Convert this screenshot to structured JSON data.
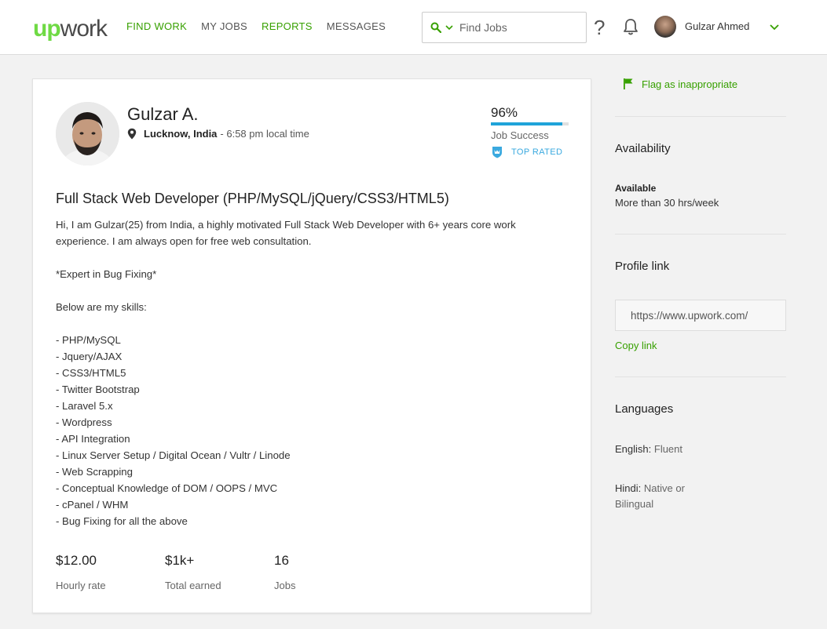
{
  "header": {
    "logo_up": "up",
    "logo_work": "work",
    "nav": [
      {
        "label": "FIND WORK"
      },
      {
        "label": "MY JOBS"
      },
      {
        "label": "REPORTS"
      },
      {
        "label": "MESSAGES"
      }
    ],
    "search_placeholder": "Find Jobs",
    "help_glyph": "?",
    "user_name": "Gulzar Ahmed"
  },
  "profile": {
    "name": "Gulzar A.",
    "city": "Lucknow, India",
    "local_time": "- 6:58 pm local time",
    "job_success_pct": "96%",
    "job_success_value": 0.92,
    "job_success_label": "Job Success",
    "top_rated": "TOP RATED",
    "title": "Full Stack Web Developer (PHP/MySQL/jQuery/CSS3/HTML5)",
    "description": [
      "Hi, I am Gulzar(25) from India, a highly motivated Full Stack Web Developer with 6+ years core work experience. I am always open for free web consultation.",
      "",
      "*Expert in Bug Fixing*",
      "",
      "Below are my skills:",
      "",
      "- PHP/MySQL",
      "- Jquery/AJAX",
      "- CSS3/HTML5",
      "- Twitter Bootstrap",
      "- Laravel 5.x",
      "- Wordpress",
      "- API Integration",
      "- Linux Server Setup / Digital Ocean / Vultr / Linode",
      "- Web Scrapping",
      "- Conceptual Knowledge of DOM / OOPS / MVC",
      "- cPanel / WHM",
      "- Bug Fixing for all the above"
    ],
    "stats": [
      {
        "value": "$12.00",
        "label": "Hourly rate"
      },
      {
        "value": "$1k+",
        "label": "Total earned"
      },
      {
        "value": "16",
        "label": "Jobs"
      }
    ]
  },
  "sidebar": {
    "flag_label": "Flag as inappropriate",
    "availability_heading": "Availability",
    "availability_status": "Available",
    "availability_hours": "More than 30 hrs/week",
    "profile_link_heading": "Profile link",
    "profile_link_value": "https://www.upwork.com/",
    "copy_link": "Copy link",
    "languages_heading": "Languages",
    "languages": [
      {
        "name": "English:",
        "level": "Fluent"
      },
      {
        "name": "Hindi:",
        "level": "Native or Bilingual"
      }
    ]
  },
  "colors": {
    "brand_green": "#37a000",
    "logo_green": "#6fda44",
    "job_success_blue": "#1fa3d9",
    "top_rated_blue": "#3aa9df"
  }
}
